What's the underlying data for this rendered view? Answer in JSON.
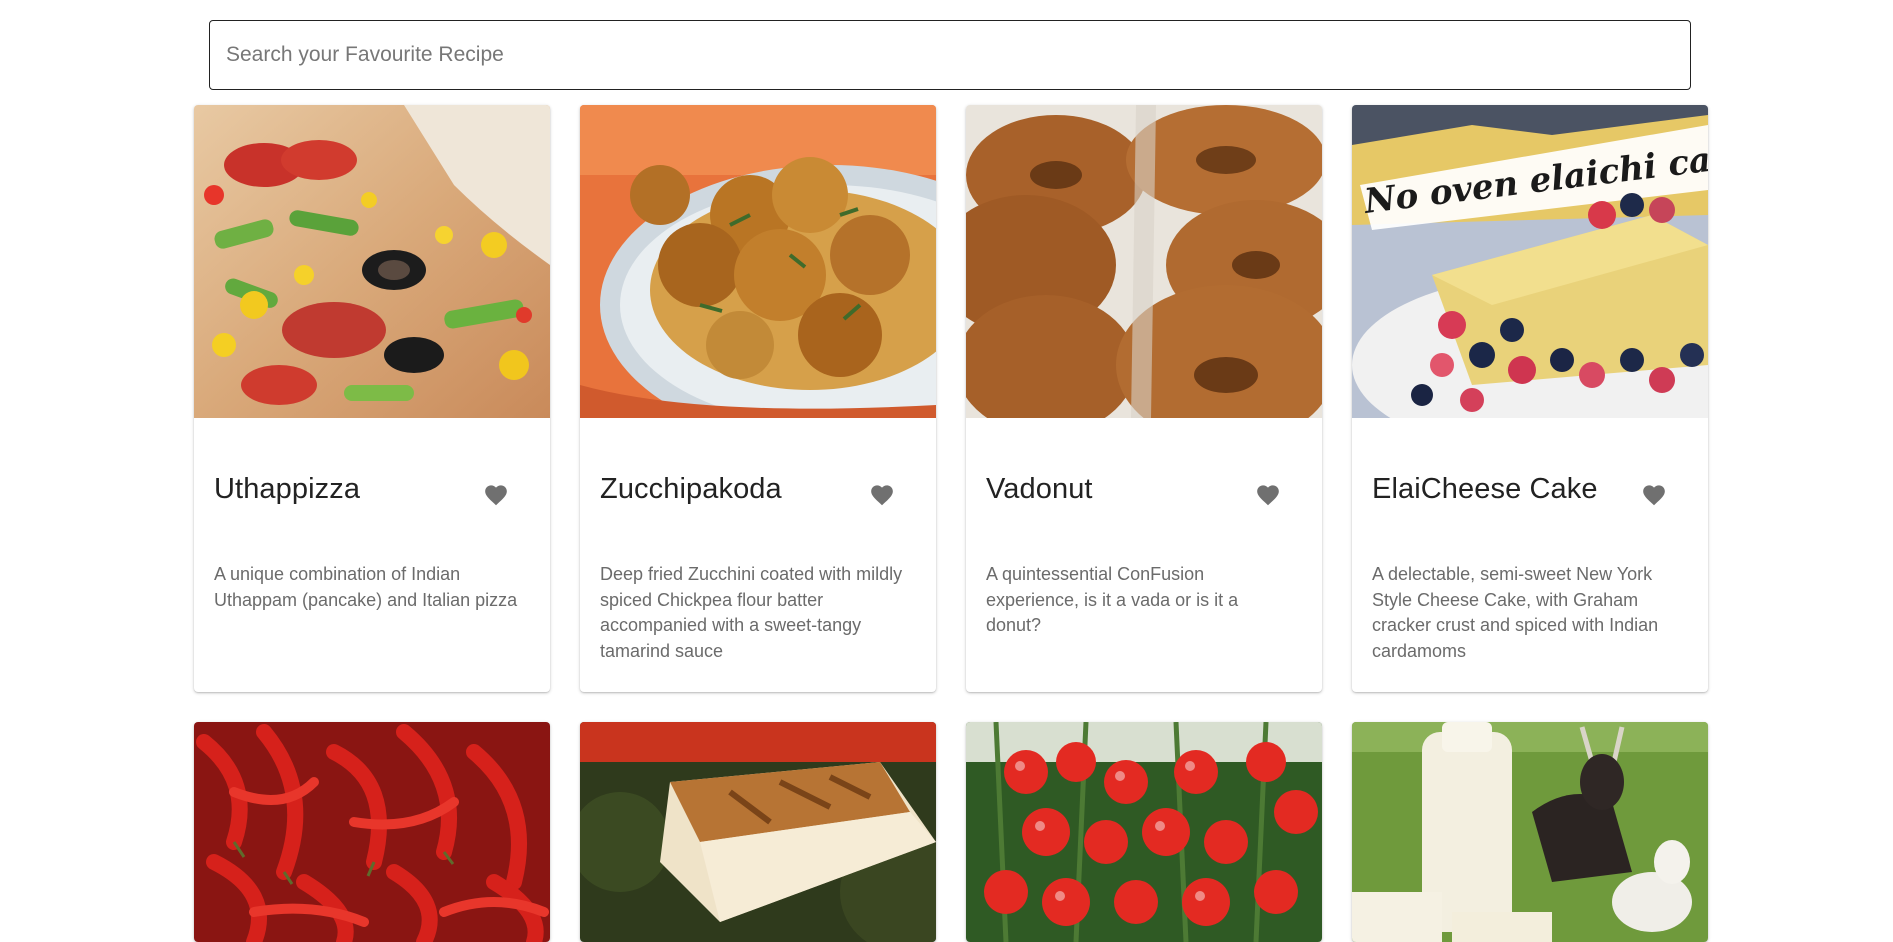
{
  "search": {
    "placeholder": "Search your Favourite Recipe",
    "value": ""
  },
  "recipes": [
    {
      "title": "Uthappizza",
      "description": "A unique combination of Indian Uthappam (pancake) and Italian pizza",
      "image_icon": "pizza-image",
      "favorite_icon": "heart-icon"
    },
    {
      "title": "Zucchipakoda",
      "description": "Deep fried Zucchini coated with mildly spiced Chickpea flour batter accompanied with a sweet-tangy tamarind sauce",
      "image_icon": "pakoda-image",
      "favorite_icon": "heart-icon"
    },
    {
      "title": "Vadonut",
      "description": "A quintessential ConFusion experience, is it a vada or is it a donut?",
      "image_icon": "donut-image",
      "favorite_icon": "heart-icon"
    },
    {
      "title": "ElaiCheese Cake",
      "description": "A delectable, semi-sweet New York Style Cheese Cake, with Graham cracker crust and spiced with Indian cardamoms",
      "image_icon": "cheesecake-image",
      "image_caption": "No oven elaichi cake",
      "favorite_icon": "heart-icon"
    }
  ],
  "partial_row": [
    {
      "image_icon": "chilli-image"
    },
    {
      "image_icon": "paneer-image"
    },
    {
      "image_icon": "tomato-image"
    },
    {
      "image_icon": "goat-milk-image"
    }
  ],
  "colors": {
    "heart": "#707070",
    "title": "#222222",
    "description": "#6b6b6b",
    "search_border": "#222222"
  }
}
